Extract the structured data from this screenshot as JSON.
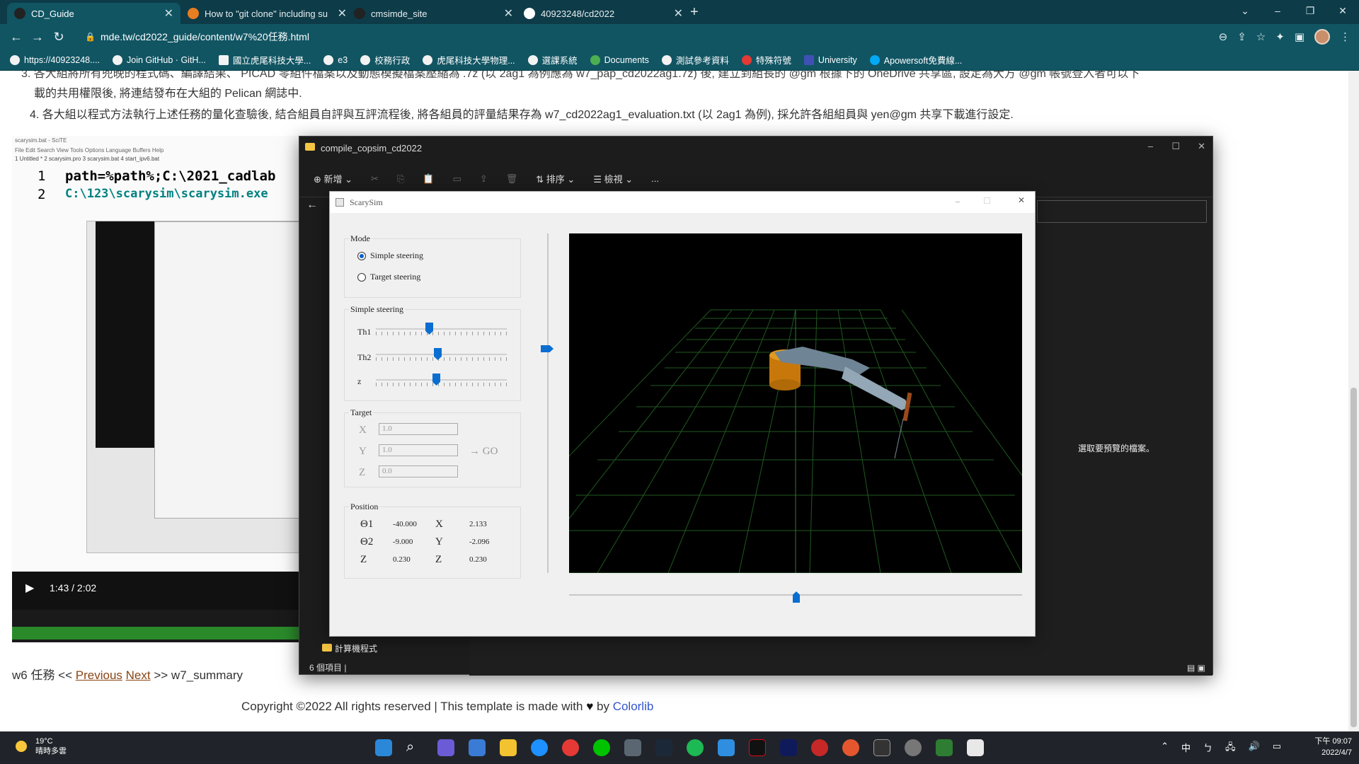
{
  "browser": {
    "tabs": [
      {
        "title": "CD_Guide",
        "active": true
      },
      {
        "title": "How to \"git clone\" including su",
        "active": false
      },
      {
        "title": "cmsimde_site",
        "active": false
      },
      {
        "title": "40923248/cd2022",
        "active": false
      }
    ],
    "new_tab": "+",
    "url": "mde.tw/cd2022_guide/content/w7%20任務.html",
    "bookmarks": [
      "https://40923248....",
      "Join GitHub · GitH...",
      "國立虎尾科技大學...",
      "e3",
      "校務行政",
      "虎尾科技大學物理...",
      "選課系統",
      "Documents",
      "測試參考資料",
      "特殊符號",
      "University",
      "Apowersoft免費線..."
    ]
  },
  "page": {
    "line_partial": "3. 各大組將所有兜晚的程式碼、編譯結果、 PICAD 零組件檔案以及動態模擬檔案壓縮為 .7z (以 2ag1 為例應為 w7_pap_cd2022ag1.7z) 後, 建立到組長的 @gm 根據下的 OneDrive 共享區, 設定為大方 @gm 帳號登入者可以下",
    "line_partial2": "載的共用權限後, 將連結發布在大組的 Pelican 網誌中.",
    "line4": "4. 各大組以程式方法執行上述任務的量化查驗後, 結合組員自評與互評流程後, 將各組員的評量結果存為 w7_cd2022ag1_evaluation.txt (以 2ag1 為例), 採允許各組組員與 yen@gm 共享下載進行設定.",
    "video": {
      "scite_title": "scarysim.bat - SciTE",
      "scite_menu": "File  Edit  Search  View  Tools  Options  Language  Buffers  Help",
      "scite_tabs": "1 Untitled *   2 scarysim.pro   3 scarysim.bat   4 start_ipv6.bat",
      "code_line1_num": "1",
      "code_line1": "path=%path%;C:\\2021_cadlab",
      "code_line2_num": "2",
      "code_line2": "C:\\123\\scarysim\\scarysim.exe",
      "time": "1:43 / 2:02"
    },
    "nav_prefix": "w6 任務 << ",
    "nav_prev": "Previous",
    "nav_next": "Next",
    "nav_suffix": " >> w7_summary",
    "copyright_text": "Copyright ©2022 All rights reserved | This template is made with ",
    "copyright_by": " by ",
    "copyright_link": "Colorlib"
  },
  "explorer": {
    "title": "compile_copsim_cd2022",
    "toolbar": {
      "new": "新增",
      "sort": "排序",
      "view": "檢視",
      "more": "..."
    },
    "side_item": "計算機程式",
    "status": "6 個項目",
    "preview_msg": "選取要預覽的檔案。"
  },
  "scarysim": {
    "title": "ScarySim",
    "mode": {
      "label": "Mode",
      "options": [
        "Simple steering",
        "Target steering"
      ],
      "selected": "Simple steering"
    },
    "simple": {
      "label": "Simple steering",
      "sliders": [
        {
          "name": "Th1",
          "value": 0.4
        },
        {
          "name": "Th2",
          "value": 0.47
        },
        {
          "name": "z",
          "value": 0.46
        }
      ]
    },
    "target": {
      "label": "Target",
      "fields": [
        {
          "name": "X",
          "value": "1.0"
        },
        {
          "name": "Y",
          "value": "1.0"
        },
        {
          "name": "Z",
          "value": "0.0"
        }
      ],
      "go": "→ GO"
    },
    "position": {
      "label": "Position",
      "rows": [
        {
          "a": "Θ1",
          "av": "-40.000",
          "b": "X",
          "bv": "2.133"
        },
        {
          "a": "Θ2",
          "av": "-9.000",
          "b": "Y",
          "bv": "-2.096"
        },
        {
          "a": "Z",
          "av": "0.230",
          "b": "Z",
          "bv": "0.230"
        }
      ]
    }
  },
  "taskbar": {
    "weather_temp": "19°C",
    "weather_desc": "晴時多雲",
    "time": "下午 09:07",
    "date": "2022/4/7",
    "ime": "中"
  }
}
